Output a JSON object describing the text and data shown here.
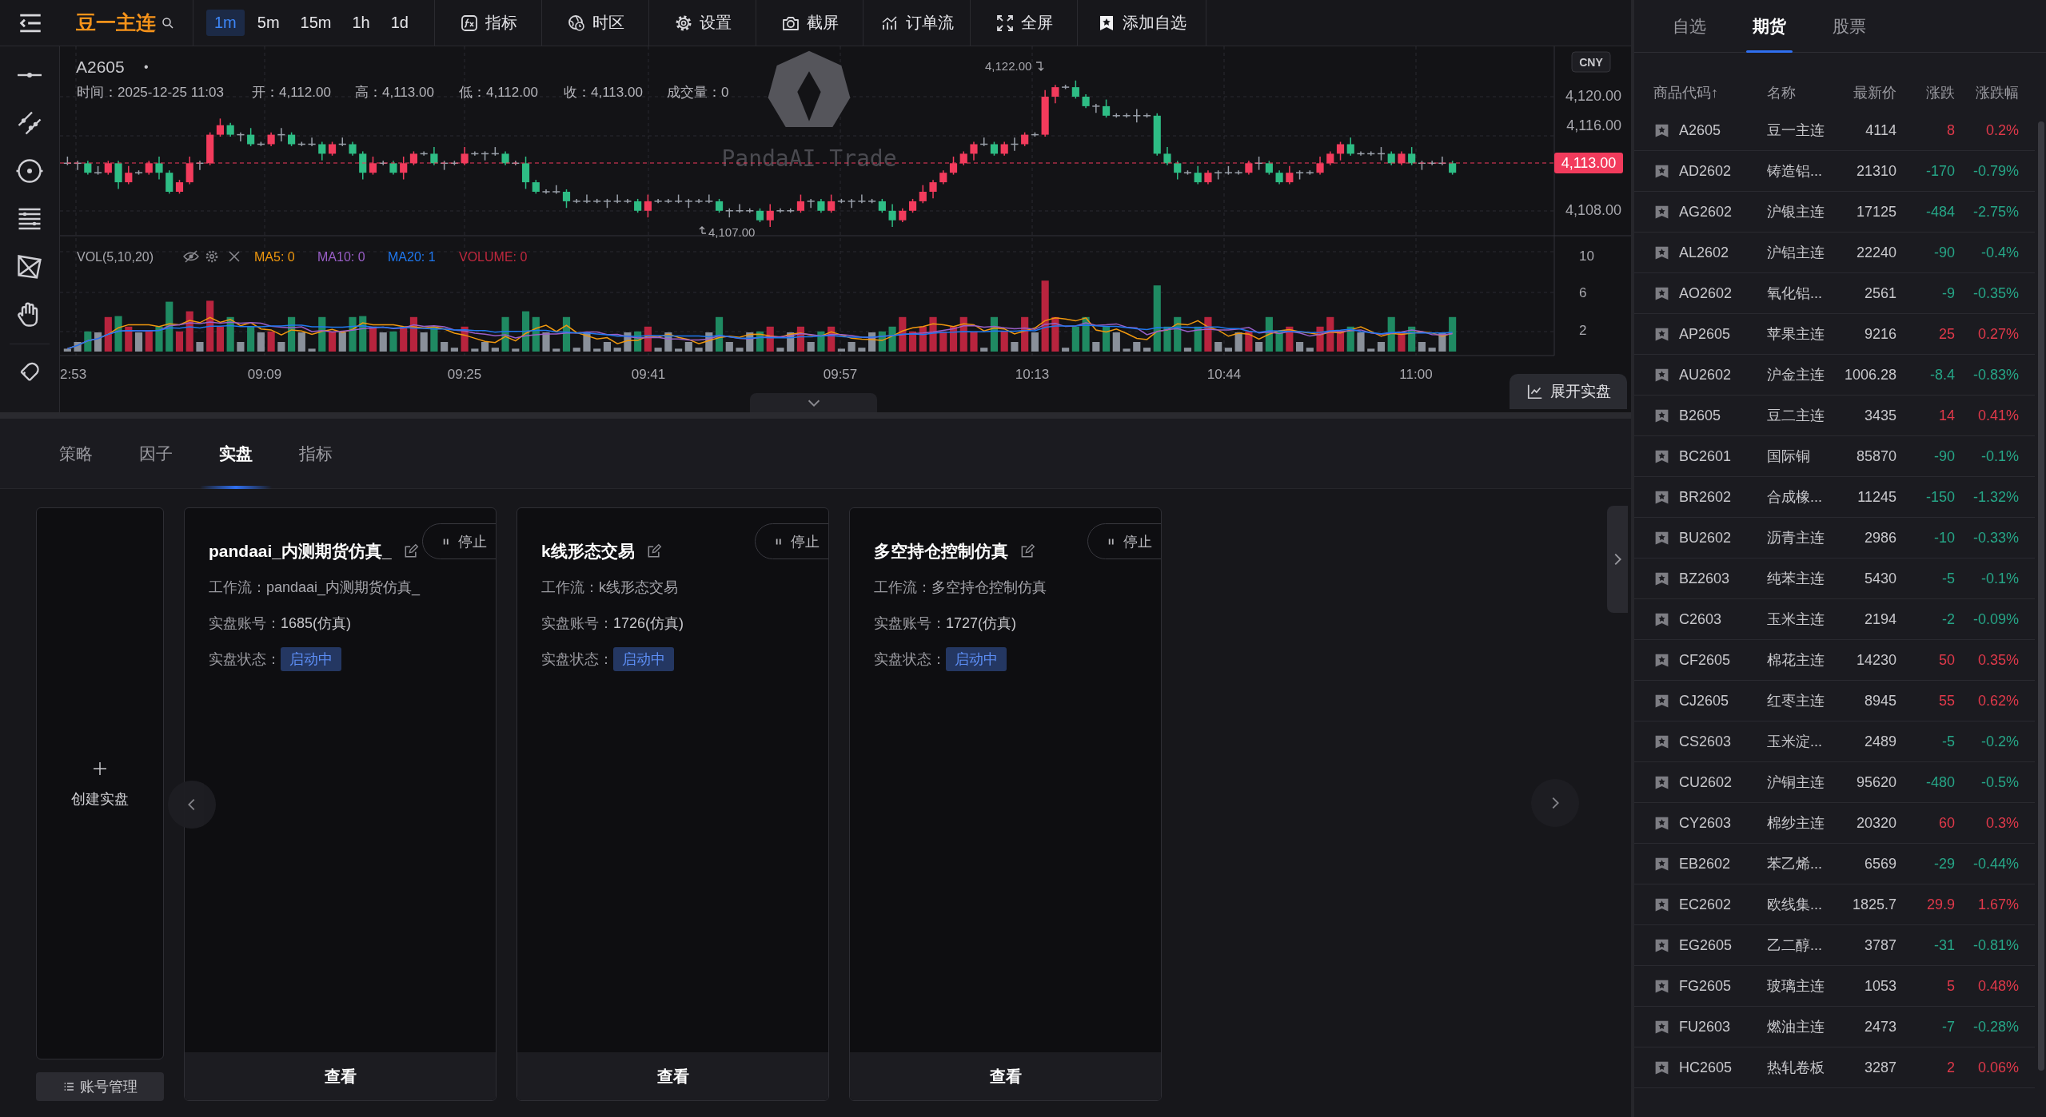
{
  "toolbar": {
    "symbol": "豆一主连",
    "intervals": [
      {
        "label": "1m",
        "selected": true
      },
      {
        "label": "5m",
        "selected": false
      },
      {
        "label": "15m",
        "selected": false
      },
      {
        "label": "1h",
        "selected": false
      },
      {
        "label": "1d",
        "selected": false
      }
    ],
    "actions": [
      {
        "kind": "indicator",
        "label": "指标"
      },
      {
        "kind": "timezone",
        "label": "时区"
      },
      {
        "kind": "settings",
        "label": "设置"
      },
      {
        "kind": "screenshot",
        "label": "截屏"
      },
      {
        "kind": "orderflow",
        "label": "订单流"
      },
      {
        "kind": "fullscreen",
        "label": "全屏"
      },
      {
        "kind": "favorite",
        "label": "添加自选"
      }
    ]
  },
  "chart": {
    "symbol": "A2605",
    "marker": "•",
    "info": [
      "时间：2025-12-25 11:03",
      "开：4,112.00",
      "高：4,113.00",
      "低：4,112.00",
      "收：4,113.00",
      "成交量：0"
    ],
    "high_label": "4,122.00",
    "low_label": "4,107.00",
    "watermark": "PandaAI Trade",
    "currency": "CNY",
    "price_ticks": [
      "4,120.00",
      "4,116.00",
      "4,108.00"
    ],
    "last_price": "4,113.00",
    "volume_legend": {
      "title": "VOL(5,10,20)",
      "items": [
        {
          "label": "MA5: 0",
          "color": "#f0980e"
        },
        {
          "label": "MA10: 0",
          "color": "#9a5fc8"
        },
        {
          "label": "MA20: 1",
          "color": "#1f78f0"
        },
        {
          "label": "VOLUME: 0",
          "color": "#c0283e"
        }
      ]
    },
    "volume_ticks": [
      "10",
      "6",
      "2"
    ],
    "time_labels": [
      "2:53",
      "09:09",
      "09:25",
      "09:41",
      "09:57",
      "10:13",
      "10:44",
      "11:00"
    ],
    "expand_button": "展开实盘"
  },
  "live": {
    "tabs": [
      {
        "label": "策略",
        "selected": false
      },
      {
        "label": "因子",
        "selected": false
      },
      {
        "label": "实盘",
        "selected": true
      },
      {
        "label": "指标",
        "selected": false
      }
    ],
    "create_label": "创建实盘",
    "account_button": "账号管理",
    "strategies": [
      {
        "title": "pandaai_内测期货仿真_",
        "stop_label": "停止",
        "workflow_label": "工作流：",
        "workflow": "pandaai_内测期货仿真_",
        "account_label": "实盘账号：",
        "account": "1685(仿真)",
        "status_label": "实盘状态：",
        "status": "启动中",
        "view_label": "查看"
      },
      {
        "title": "k线形态交易",
        "stop_label": "停止",
        "workflow_label": "工作流：",
        "workflow": "k线形态交易",
        "account_label": "实盘账号：",
        "account": "1726(仿真)",
        "status_label": "实盘状态：",
        "status": "启动中",
        "view_label": "查看"
      },
      {
        "title": "多空持仓控制仿真",
        "stop_label": "停止",
        "workflow_label": "工作流：",
        "workflow": "多空持仓控制仿真",
        "account_label": "实盘账号：",
        "account": "1727(仿真)",
        "status_label": "实盘状态：",
        "status": "启动中",
        "view_label": "查看"
      }
    ]
  },
  "quotes": {
    "tabs": [
      {
        "label": "自选",
        "selected": false
      },
      {
        "label": "期货",
        "selected": true
      },
      {
        "label": "股票",
        "selected": false
      }
    ],
    "columns": [
      "商品代码↑",
      "名称",
      "最新价",
      "涨跌",
      "涨跌幅"
    ],
    "rows": [
      {
        "code": "A2605",
        "name": "豆一主连",
        "price": "4114",
        "change": "8",
        "pct": "0.2%",
        "color": "#e0394a"
      },
      {
        "code": "AD2602",
        "name": "铸造铝...",
        "price": "21310",
        "change": "-170",
        "pct": "-0.79%",
        "color": "#26a687"
      },
      {
        "code": "AG2602",
        "name": "沪银主连",
        "price": "17125",
        "change": "-484",
        "pct": "-2.75%",
        "color": "#26a687"
      },
      {
        "code": "AL2602",
        "name": "沪铝主连",
        "price": "22240",
        "change": "-90",
        "pct": "-0.4%",
        "color": "#26a687"
      },
      {
        "code": "AO2602",
        "name": "氧化铝...",
        "price": "2561",
        "change": "-9",
        "pct": "-0.35%",
        "color": "#26a687"
      },
      {
        "code": "AP2605",
        "name": "苹果主连",
        "price": "9216",
        "change": "25",
        "pct": "0.27%",
        "color": "#e0394a"
      },
      {
        "code": "AU2602",
        "name": "沪金主连",
        "price": "1006.28",
        "change": "-8.4",
        "pct": "-0.83%",
        "color": "#26a687"
      },
      {
        "code": "B2605",
        "name": "豆二主连",
        "price": "3435",
        "change": "14",
        "pct": "0.41%",
        "color": "#e0394a"
      },
      {
        "code": "BC2601",
        "name": "国际铜",
        "price": "85870",
        "change": "-90",
        "pct": "-0.1%",
        "color": "#26a687"
      },
      {
        "code": "BR2602",
        "name": "合成橡...",
        "price": "11245",
        "change": "-150",
        "pct": "-1.32%",
        "color": "#26a687"
      },
      {
        "code": "BU2602",
        "name": "沥青主连",
        "price": "2986",
        "change": "-10",
        "pct": "-0.33%",
        "color": "#26a687"
      },
      {
        "code": "BZ2603",
        "name": "纯苯主连",
        "price": "5430",
        "change": "-5",
        "pct": "-0.1%",
        "color": "#26a687"
      },
      {
        "code": "C2603",
        "name": "玉米主连",
        "price": "2194",
        "change": "-2",
        "pct": "-0.09%",
        "color": "#26a687"
      },
      {
        "code": "CF2605",
        "name": "棉花主连",
        "price": "14230",
        "change": "50",
        "pct": "0.35%",
        "color": "#e0394a"
      },
      {
        "code": "CJ2605",
        "name": "红枣主连",
        "price": "8945",
        "change": "55",
        "pct": "0.62%",
        "color": "#e0394a"
      },
      {
        "code": "CS2603",
        "name": "玉米淀...",
        "price": "2489",
        "change": "-5",
        "pct": "-0.2%",
        "color": "#26a687"
      },
      {
        "code": "CU2602",
        "name": "沪铜主连",
        "price": "95620",
        "change": "-480",
        "pct": "-0.5%",
        "color": "#26a687"
      },
      {
        "code": "CY2603",
        "name": "棉纱主连",
        "price": "20320",
        "change": "60",
        "pct": "0.3%",
        "color": "#e0394a"
      },
      {
        "code": "EB2602",
        "name": "苯乙烯...",
        "price": "6569",
        "change": "-29",
        "pct": "-0.44%",
        "color": "#26a687"
      },
      {
        "code": "EC2602",
        "name": "欧线集...",
        "price": "1825.7",
        "change": "29.9",
        "pct": "1.67%",
        "color": "#e0394a"
      },
      {
        "code": "EG2605",
        "name": "乙二醇...",
        "price": "3787",
        "change": "-31",
        "pct": "-0.81%",
        "color": "#26a687"
      },
      {
        "code": "FG2605",
        "name": "玻璃主连",
        "price": "1053",
        "change": "5",
        "pct": "0.48%",
        "color": "#e0394a"
      },
      {
        "code": "FU2603",
        "name": "燃油主连",
        "price": "2473",
        "change": "-7",
        "pct": "-0.28%",
        "color": "#26a687"
      },
      {
        "code": "HC2605",
        "name": "热轧卷板",
        "price": "3287",
        "change": "2",
        "pct": "0.06%",
        "color": "#e0394a"
      }
    ]
  }
}
